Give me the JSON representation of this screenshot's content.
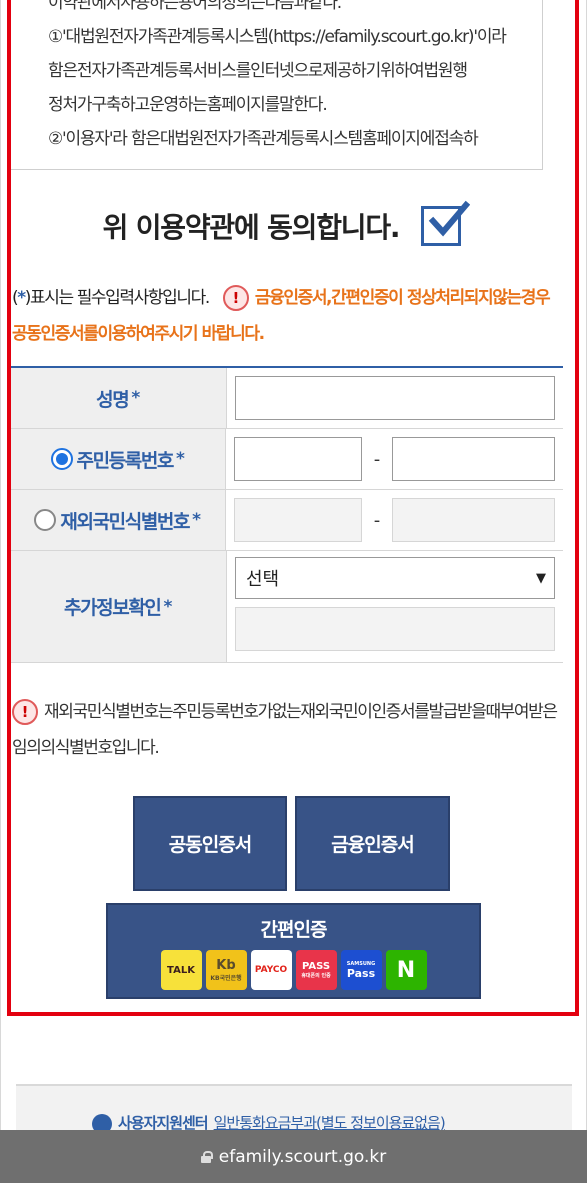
{
  "terms": {
    "lines": [
      "이약관에서사용하는용어의정의는다음과같다.",
      "①'대법원전자가족관계등록시스템(https://efamily.scourt.go.kr)'이라",
      "함은전자가족관계등록서비스를인터넷으로제공하기위하여법원행",
      "정처가구축하고운영하는홈페이지를말한다.",
      "②'이용자'라 함은대법원전자가족관계등록시스템홈페이지에접속하"
    ]
  },
  "agree": {
    "label": "위 이용약관에 동의합니다.",
    "checked": true
  },
  "notice": {
    "required_prefix": "(",
    "required_star": "*",
    "required_suffix": ")표시는 필수입력사항입니다.",
    "warn_symbol": "!",
    "warning": "금융인증서,간편인증이 정상처리되지않는경우 공동인증서를이용하여주시기 바랍니다."
  },
  "form": {
    "required_mark": "*",
    "name_label": "성명",
    "resident_label": "주민등록번호",
    "foreign_label": "재외국민식별번호",
    "extra_label": "추가정보확인",
    "dash": "-",
    "select_value": "선택",
    "select_arrow": "▼",
    "resident_selected": true
  },
  "foreign_note": {
    "warn_symbol": "!",
    "text": "재외국민식별번호는주민등록번호가없는재외국민이인증서를발급받을때부여받은임의의식별번호입니다."
  },
  "buttons": {
    "joint_cert": "공동인증서",
    "finance_cert": "금융인증서",
    "simple_auth": "간편인증"
  },
  "simple_auth_providers": {
    "kakao": "TALK",
    "kb_top": "Kb",
    "kb_bottom": "KB국민은행",
    "payco": "PAYCO",
    "pass_top": "PASS",
    "pass_bottom": "휴대폰의 인증",
    "samsung_top": "SAMSUNG",
    "samsung_bottom": "Pass",
    "naver": "N"
  },
  "footer": {
    "support_name": "사용자지원센터",
    "support_info": "일반통화요금부과(별도 정보이용료없음)"
  },
  "browser": {
    "url": "efamily.scourt.go.kr"
  }
}
